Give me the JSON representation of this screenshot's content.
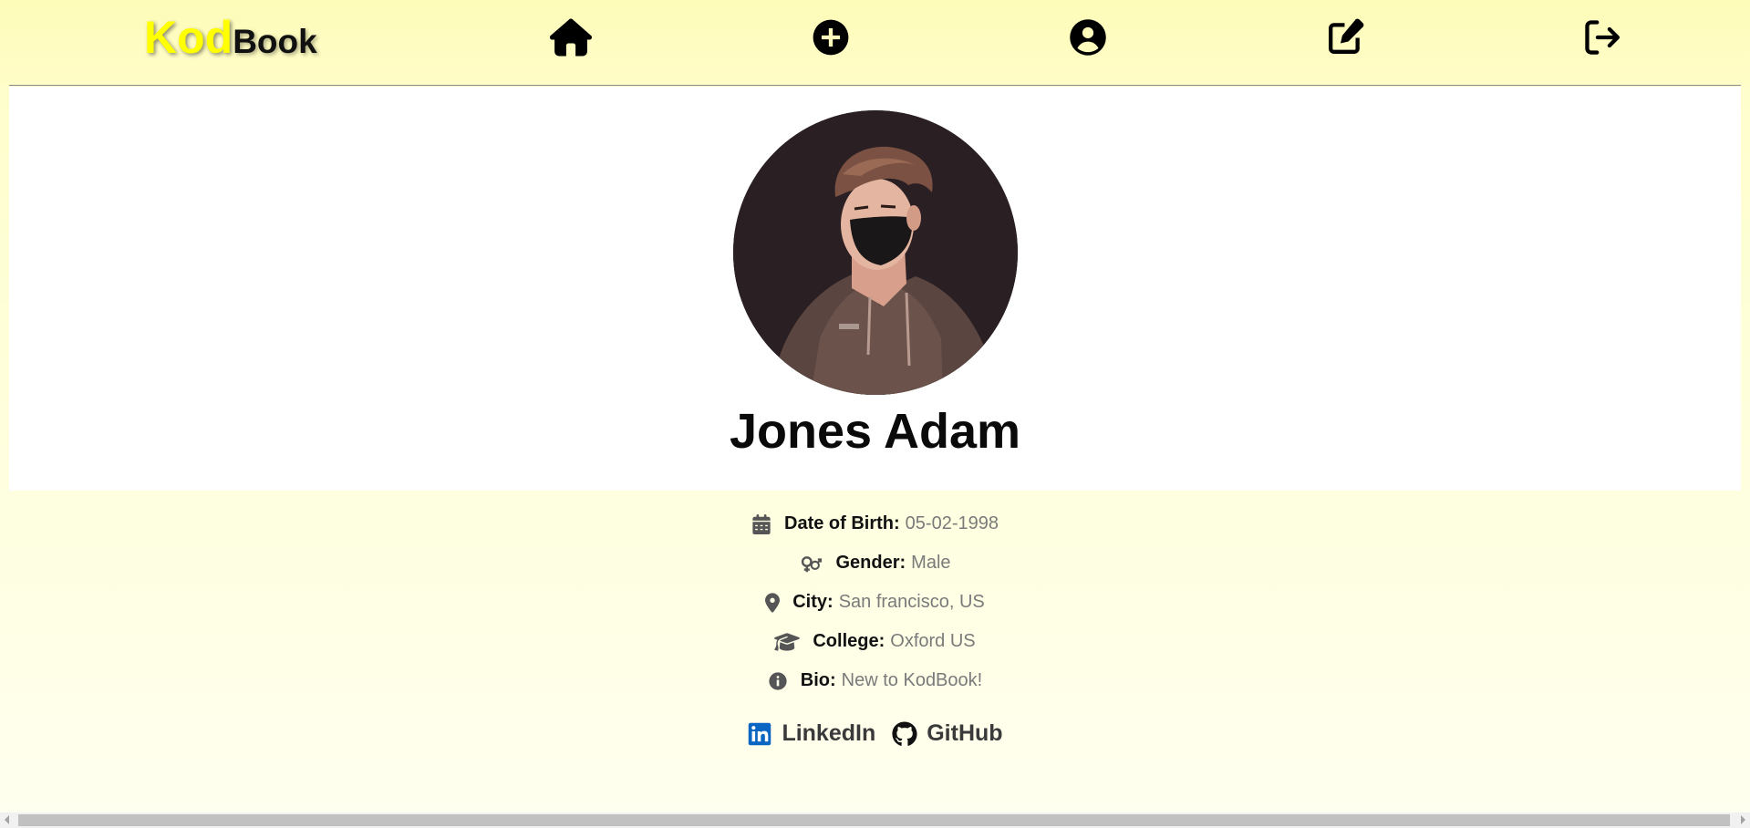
{
  "brand": {
    "logo_part1": "Kod",
    "logo_part2": "Book",
    "logo_color": "#ffff00"
  },
  "nav": {
    "items": [
      {
        "name": "home",
        "icon": "home-icon"
      },
      {
        "name": "create-post",
        "icon": "plus-circle-icon"
      },
      {
        "name": "profile",
        "icon": "user-circle-icon"
      },
      {
        "name": "edit-profile",
        "icon": "edit-icon"
      },
      {
        "name": "logout",
        "icon": "logout-icon"
      }
    ]
  },
  "profile": {
    "name": "Jones Adam",
    "avatar_alt": "profile-photo",
    "details": [
      {
        "icon": "calendar-icon",
        "label": "Date of Birth:",
        "value": "05-02-1998"
      },
      {
        "icon": "gender-icon",
        "label": "Gender:",
        "value": "Male"
      },
      {
        "icon": "location-pin-icon",
        "label": "City:",
        "value": "San francisco, US"
      },
      {
        "icon": "graduation-cap-icon",
        "label": "College:",
        "value": "Oxford US"
      },
      {
        "icon": "info-icon",
        "label": "Bio:",
        "value": "New to KodBook!"
      }
    ]
  },
  "social": {
    "linkedin": {
      "label": "LinkedIn",
      "icon": "linkedin-icon",
      "color": "#0a66c2"
    },
    "github": {
      "label": "GitHub",
      "icon": "github-icon",
      "color": "#111111"
    }
  },
  "colors": {
    "header_bg": "#fefcb8",
    "page_bg": "#fffff0",
    "label": "#111111",
    "value": "#7a7a7a"
  }
}
